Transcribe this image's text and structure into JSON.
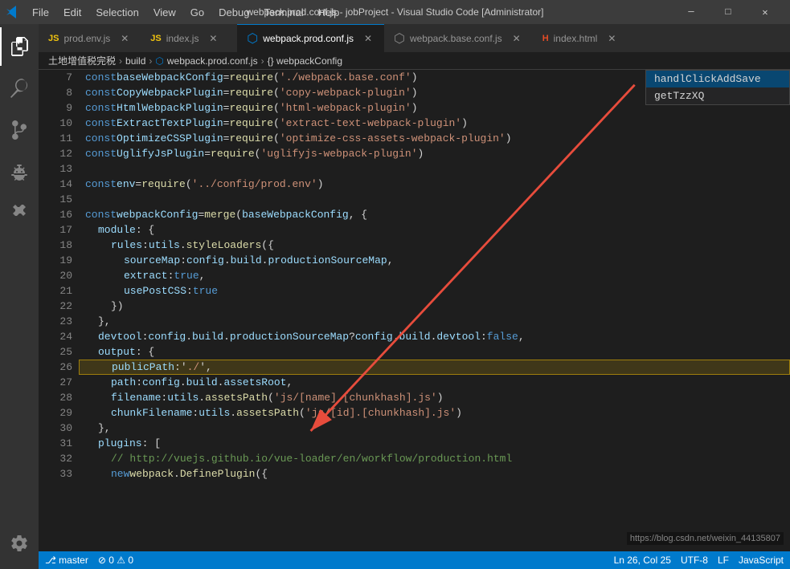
{
  "titleBar": {
    "icon": "✦",
    "menuItems": [
      "File",
      "Edit",
      "Selection",
      "View",
      "Go",
      "Debug",
      "Terminal",
      "Help"
    ],
    "title": "webpack.prod.conf.js - jobProject - Visual Studio Code [Administrator]",
    "controls": [
      "─",
      "□",
      "✕"
    ]
  },
  "tabs": [
    {
      "id": "prod-env",
      "label": "prod.env.js",
      "type": "js",
      "active": false,
      "modified": false
    },
    {
      "id": "index-js",
      "label": "index.js",
      "type": "js",
      "active": false,
      "modified": false
    },
    {
      "id": "webpack-prod",
      "label": "webpack.prod.conf.js",
      "type": "webpack",
      "active": true,
      "modified": false
    },
    {
      "id": "webpack-base",
      "label": "webpack.base.conf.js",
      "type": "webpack",
      "active": false,
      "modified": false
    },
    {
      "id": "index-html",
      "label": "index.html",
      "type": "html",
      "active": false,
      "modified": false
    }
  ],
  "breadcrumb": {
    "items": [
      "土地增值税完税",
      "build",
      "webpack.prod.conf.js",
      "{} webpackConfig"
    ]
  },
  "autocomplete": {
    "items": [
      "handlClickAddSave",
      "getTzzXQ"
    ]
  },
  "statusBar": {
    "branch": "master",
    "errors": "⊘ 0  ⚠ 0",
    "encoding": "UTF-8",
    "lineEnding": "LF",
    "language": "JavaScript",
    "position": "Ln 26, Col 25"
  },
  "watermark": "https://blog.csdn.net/weixin_44135807",
  "lines": [
    {
      "num": 7,
      "indent": 0,
      "tokens": [
        [
          "kw",
          "const "
        ],
        [
          "var",
          "baseWebpackConfig"
        ],
        [
          "op",
          " = "
        ],
        [
          "fn",
          "require"
        ],
        [
          "punc",
          "("
        ],
        [
          "str",
          "'./webpack.base.conf'"
        ],
        [
          "punc",
          ")"
        ]
      ]
    },
    {
      "num": 8,
      "indent": 0,
      "tokens": [
        [
          "kw",
          "const "
        ],
        [
          "var",
          "CopyWebpackPlugin"
        ],
        [
          "op",
          " = "
        ],
        [
          "fn",
          "require"
        ],
        [
          "punc",
          "("
        ],
        [
          "str",
          "'copy-webpack-plugin'"
        ],
        [
          "punc",
          ")"
        ]
      ]
    },
    {
      "num": 9,
      "indent": 0,
      "tokens": [
        [
          "kw",
          "const "
        ],
        [
          "var",
          "HtmlWebpackPlugin"
        ],
        [
          "op",
          " = "
        ],
        [
          "fn",
          "require"
        ],
        [
          "punc",
          "("
        ],
        [
          "str",
          "'html-webpack-plugin'"
        ],
        [
          "punc",
          ")"
        ]
      ]
    },
    {
      "num": 10,
      "indent": 0,
      "tokens": [
        [
          "kw",
          "const "
        ],
        [
          "var",
          "ExtractTextPlugin"
        ],
        [
          "op",
          " = "
        ],
        [
          "fn",
          "require"
        ],
        [
          "punc",
          "("
        ],
        [
          "str",
          "'extract-text-webpack-plugin'"
        ],
        [
          "punc",
          ")"
        ]
      ]
    },
    {
      "num": 11,
      "indent": 0,
      "tokens": [
        [
          "kw",
          "const "
        ],
        [
          "var",
          "OptimizeCSSPlugin"
        ],
        [
          "op",
          " = "
        ],
        [
          "fn",
          "require"
        ],
        [
          "punc",
          "("
        ],
        [
          "str",
          "'optimize-css-assets-webpack-plugin'"
        ],
        [
          "punc",
          ")"
        ]
      ]
    },
    {
      "num": 12,
      "indent": 0,
      "tokens": [
        [
          "kw",
          "const "
        ],
        [
          "var",
          "UglifyJsPlugin"
        ],
        [
          "op",
          " = "
        ],
        [
          "fn",
          "require"
        ],
        [
          "punc",
          "("
        ],
        [
          "str",
          "'uglifyjs-webpack-plugin'"
        ],
        [
          "punc",
          ")"
        ]
      ]
    },
    {
      "num": 13,
      "indent": 0,
      "tokens": []
    },
    {
      "num": 14,
      "indent": 0,
      "tokens": [
        [
          "kw",
          "const "
        ],
        [
          "var",
          "env"
        ],
        [
          "op",
          " = "
        ],
        [
          "fn",
          "require"
        ],
        [
          "punc",
          "("
        ],
        [
          "str",
          "'../config/prod.env'"
        ],
        [
          "punc",
          ")"
        ]
      ]
    },
    {
      "num": 15,
      "indent": 0,
      "tokens": []
    },
    {
      "num": 16,
      "indent": 0,
      "tokens": [
        [
          "kw",
          "const "
        ],
        [
          "var",
          "webpackConfig"
        ],
        [
          "op",
          " = "
        ],
        [
          "fn",
          "merge"
        ],
        [
          "punc",
          "("
        ],
        [
          "var",
          "baseWebpackConfig"
        ],
        [
          "punc",
          ", {"
        ]
      ]
    },
    {
      "num": 17,
      "indent": 2,
      "tokens": [
        [
          "prop",
          "module"
        ],
        [
          "punc",
          ": {"
        ]
      ]
    },
    {
      "num": 18,
      "indent": 4,
      "tokens": [
        [
          "prop",
          "rules"
        ],
        [
          "punc",
          ": "
        ],
        [
          "var",
          "utils"
        ],
        [
          "punc",
          "."
        ],
        [
          "fn",
          "styleLoaders"
        ],
        [
          "punc",
          "({"
        ]
      ]
    },
    {
      "num": 19,
      "indent": 6,
      "tokens": [
        [
          "prop",
          "sourceMap"
        ],
        [
          "punc",
          ": "
        ],
        [
          "var",
          "config"
        ],
        [
          "punc",
          "."
        ],
        [
          "prop",
          "build"
        ],
        [
          "punc",
          "."
        ],
        [
          "prop",
          "productionSourceMap"
        ],
        [
          "punc",
          ","
        ]
      ]
    },
    {
      "num": 20,
      "indent": 6,
      "tokens": [
        [
          "prop",
          "extract"
        ],
        [
          "punc",
          ": "
        ],
        [
          "kw",
          "true"
        ],
        [
          "punc",
          ","
        ]
      ]
    },
    {
      "num": 21,
      "indent": 6,
      "tokens": [
        [
          "prop",
          "usePostCSS"
        ],
        [
          "punc",
          ": "
        ],
        [
          "kw",
          "true"
        ]
      ]
    },
    {
      "num": 22,
      "indent": 4,
      "tokens": [
        [
          "punc",
          "})"
        ]
      ]
    },
    {
      "num": 23,
      "indent": 2,
      "tokens": [
        [
          "punc",
          "},"
        ]
      ]
    },
    {
      "num": 24,
      "indent": 2,
      "tokens": [
        [
          "prop",
          "devtool"
        ],
        [
          "punc",
          ": "
        ],
        [
          "var",
          "config"
        ],
        [
          "punc",
          "."
        ],
        [
          "prop",
          "build"
        ],
        [
          "punc",
          "."
        ],
        [
          "prop",
          "productionSourceMap"
        ],
        [
          "punc",
          " ? "
        ],
        [
          "var",
          "config"
        ],
        [
          "punc",
          "."
        ],
        [
          "prop",
          "build"
        ],
        [
          "punc",
          "."
        ],
        [
          "prop",
          "devtool"
        ],
        [
          "punc",
          " : "
        ],
        [
          "kw",
          "false"
        ],
        [
          "punc",
          ","
        ]
      ]
    },
    {
      "num": 25,
      "indent": 2,
      "tokens": [
        [
          "prop",
          "output"
        ],
        [
          "punc",
          ": {"
        ]
      ]
    },
    {
      "num": 26,
      "indent": 4,
      "tokens": [
        [
          "prop",
          "publicPath"
        ],
        [
          "punc",
          ":'"
        ],
        [
          "str",
          "./"
        ],
        [
          "punc",
          "',"
        ]
      ],
      "selected": true
    },
    {
      "num": 27,
      "indent": 4,
      "tokens": [
        [
          "prop",
          "path"
        ],
        [
          "punc",
          ": "
        ],
        [
          "var",
          "config"
        ],
        [
          "punc",
          "."
        ],
        [
          "prop",
          "build"
        ],
        [
          "punc",
          "."
        ],
        [
          "prop",
          "assetsRoot"
        ],
        [
          "punc",
          ","
        ]
      ]
    },
    {
      "num": 28,
      "indent": 4,
      "tokens": [
        [
          "prop",
          "filename"
        ],
        [
          "punc",
          ": "
        ],
        [
          "var",
          "utils"
        ],
        [
          "punc",
          "."
        ],
        [
          "fn",
          "assetsPath"
        ],
        [
          "punc",
          "("
        ],
        [
          "str",
          "'js/[name].[chunkhash].js'"
        ],
        [
          "punc",
          ")"
        ]
      ]
    },
    {
      "num": 29,
      "indent": 4,
      "tokens": [
        [
          "prop",
          "chunkFilename"
        ],
        [
          "punc",
          ": "
        ],
        [
          "var",
          "utils"
        ],
        [
          "punc",
          "."
        ],
        [
          "fn",
          "assetsPath"
        ],
        [
          "punc",
          "("
        ],
        [
          "str",
          "'js/[id].[chunkhash].js'"
        ],
        [
          "punc",
          ")"
        ]
      ]
    },
    {
      "num": 30,
      "indent": 2,
      "tokens": [
        [
          "punc",
          "},"
        ]
      ]
    },
    {
      "num": 31,
      "indent": 2,
      "tokens": [
        [
          "prop",
          "plugins"
        ],
        [
          "punc",
          ": ["
        ]
      ]
    },
    {
      "num": 32,
      "indent": 4,
      "tokens": [
        [
          "cm",
          "// http://vuejs.github.io/vue-loader/en/workflow/production.html"
        ]
      ]
    },
    {
      "num": 33,
      "indent": 4,
      "tokens": [
        [
          "kw",
          "new "
        ],
        [
          "fn",
          "webpack"
        ],
        [
          "punc",
          "."
        ],
        [
          "fn",
          "DefinePlugin"
        ],
        [
          "punc",
          "({"
        ]
      ]
    }
  ]
}
